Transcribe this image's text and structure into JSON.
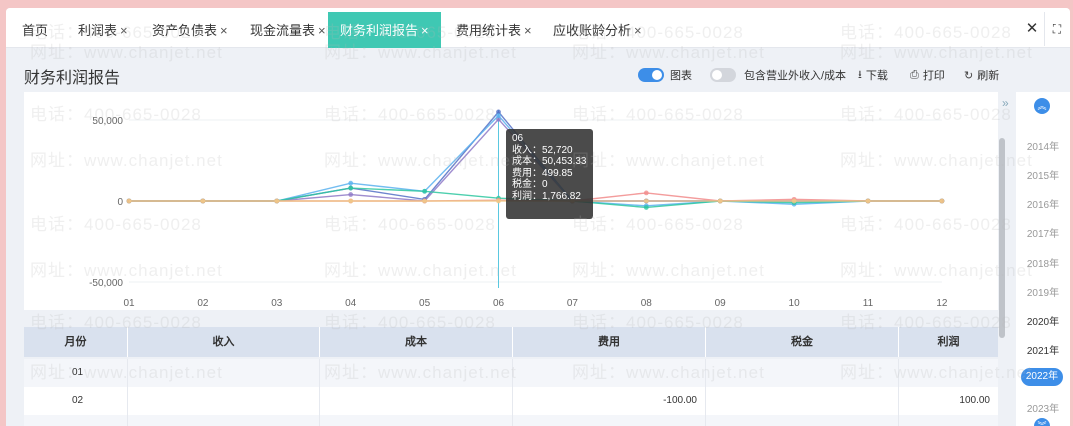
{
  "tabs": [
    {
      "label": "首页",
      "closable": false
    },
    {
      "label": "利润表",
      "closable": true
    },
    {
      "label": "资产负债表",
      "closable": true
    },
    {
      "label": "现金流量表",
      "closable": true
    },
    {
      "label": "财务利润报告",
      "closable": true,
      "active": true
    },
    {
      "label": "费用统计表",
      "closable": true
    },
    {
      "label": "应收账龄分析",
      "closable": true
    }
  ],
  "close_glyph": "×",
  "window_controls": {
    "close": "✕",
    "fullscreen": "⛶"
  },
  "page": {
    "title": "财务利润报告"
  },
  "toolbar": {
    "chart_label": "图表",
    "chart_on": true,
    "include_label": "包含营业外收入/成本",
    "include_on": false,
    "download_label": "下载",
    "print_label": "打印",
    "refresh_label": "刷新",
    "download_icon": "⭳",
    "print_icon": "⎙",
    "refresh_icon": "↻"
  },
  "chart_data": {
    "type": "line",
    "x": [
      "01",
      "02",
      "03",
      "04",
      "05",
      "06",
      "07",
      "08",
      "09",
      "10",
      "11",
      "12"
    ],
    "ytick_labels": [
      "50,000",
      "0",
      "-50,000"
    ],
    "yticks": [
      50000,
      0,
      -50000
    ],
    "ylim": [
      -50000,
      100000
    ],
    "series": [
      {
        "color": "#5470c6",
        "values": [
          0,
          0,
          0,
          8000,
          1000,
          55000,
          0,
          0,
          0,
          0,
          0,
          0
        ]
      },
      {
        "color": "#8e79c7",
        "values": [
          0,
          0,
          0,
          4000,
          0,
          50453.33,
          0,
          0,
          0,
          0,
          0,
          0
        ]
      },
      {
        "color": "#5ab1ef",
        "values": [
          0,
          0,
          0,
          11000,
          6000,
          52720,
          0,
          -3000,
          0,
          -2000,
          0,
          0
        ]
      },
      {
        "color": "#2ec7a0",
        "values": [
          0,
          0,
          0,
          8000,
          6000,
          1766.82,
          0,
          -4000,
          0,
          -1000,
          0,
          0
        ]
      },
      {
        "color": "#f18b8b",
        "values": [
          0,
          0,
          0,
          0,
          0,
          499.85,
          0,
          5000,
          0,
          1000,
          0,
          0
        ]
      },
      {
        "color": "#f0c987",
        "values": [
          0,
          0,
          0,
          0,
          0,
          0,
          0,
          0,
          0,
          0,
          0,
          0
        ]
      }
    ],
    "tooltip": {
      "month": "06",
      "lines": [
        "收入：52,720",
        "成本：50,453.33",
        "费用：499.85",
        "税金：0",
        "利润：1,766.82"
      ]
    },
    "grid": true
  },
  "table": {
    "columns": [
      "月份",
      "收入",
      "成本",
      "费用",
      "税金",
      "利润"
    ],
    "rows": [
      [
        "01",
        "",
        "",
        "",
        "",
        ""
      ],
      [
        "02",
        "",
        "",
        "-100.00",
        "",
        "100.00"
      ],
      [
        "",
        "",
        "",
        "",
        "",
        ""
      ]
    ]
  },
  "years": [
    "2014年",
    "2015年",
    "2016年",
    "2017年",
    "2018年",
    "2019年",
    "2020年",
    "2021年",
    "2022年",
    "2023年"
  ],
  "active_year": "2022年",
  "year_nav": {
    "up": "︽",
    "down": "︾"
  },
  "collapse_glyph": "»",
  "watermarks": {
    "phone": "电话：400-665-0028",
    "site": "网址：www.chanjet.net"
  }
}
